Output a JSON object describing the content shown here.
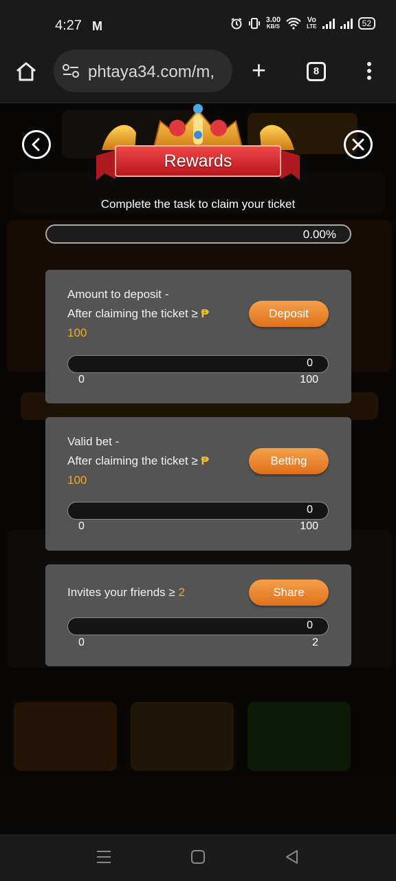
{
  "status_bar": {
    "time": "4:27",
    "mail_icon": "M",
    "net_speed_value": "3.00",
    "net_speed_unit": "KB/S",
    "volte_label_top": "Vo",
    "volte_label_bottom": "LTE",
    "battery": "52"
  },
  "browser": {
    "url": "phtaya34.com/m,",
    "tab_count": "8"
  },
  "modal": {
    "title": "Rewards",
    "subtitle": "Complete the task to claim your ticket",
    "overall_progress": {
      "label": "0.00%",
      "fraction": 0
    }
  },
  "tasks": [
    {
      "title": "Amount to deposit -",
      "condition": "After claiming the ticket ≥",
      "currency": "₱",
      "target": "100",
      "button": "Deposit",
      "current": "0",
      "min": "0",
      "max": "100",
      "fraction": 0
    },
    {
      "title": "Valid bet -",
      "condition": "After claiming the ticket ≥",
      "currency": "₱",
      "target": "100",
      "button": "Betting",
      "current": "0",
      "min": "0",
      "max": "100",
      "fraction": 0
    },
    {
      "title": "Invites your friends ≥",
      "target": "2",
      "button": "Share",
      "current": "0",
      "min": "0",
      "max": "2",
      "fraction": 0
    }
  ],
  "colors": {
    "accent": "#f0a040",
    "button_gradient_top": "#f5a04a",
    "button_gradient_bottom": "#e0701a",
    "card_bg": "#545454",
    "ribbon_red": "#d7262b"
  },
  "icons": {
    "back": "chevron-left-circle-icon",
    "close": "x-circle-icon",
    "home": "home-icon",
    "site_settings": "tune-icon",
    "new_tab": "plus-icon",
    "menu": "kebab-icon"
  }
}
